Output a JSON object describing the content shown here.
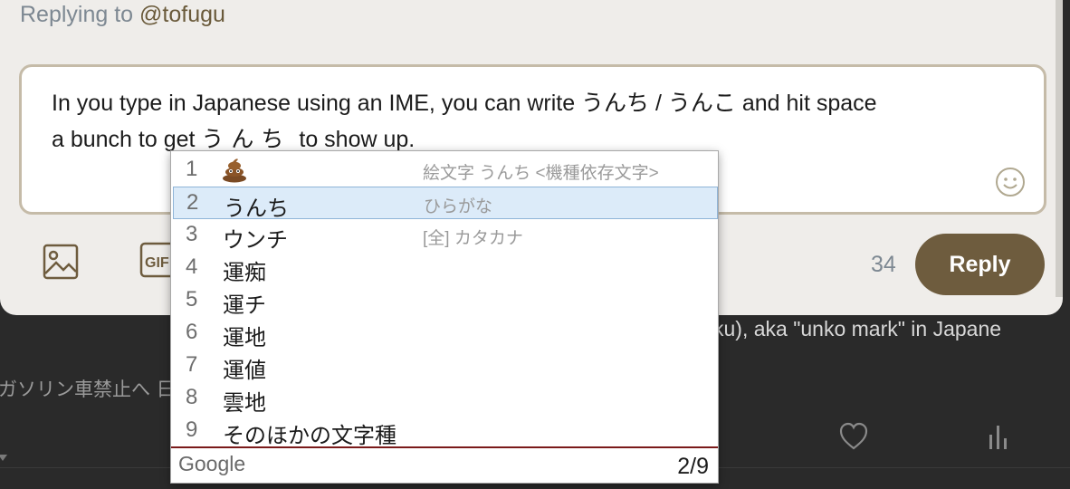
{
  "background": {
    "post_text_fragment": "ku), aka \"unko mark\" in Japane",
    "sidebar_text_fragment": "ガソリン車禁止へ 日"
  },
  "reply_modal": {
    "replying_prefix": "Replying to",
    "replying_handle": "@tofugu",
    "compose": {
      "line1": "In you type in Japanese using an IME, you can write うんち / うんこ and hit space",
      "line2_before": "a bunch to get",
      "line2_composing": "うんち",
      "line2_after": "to show up."
    },
    "char_count": "34",
    "reply_label": "Reply",
    "gif_label": "GIF"
  },
  "ime": {
    "candidates": [
      {
        "num": "1",
        "word": "",
        "icon": "pile-of-poo-icon",
        "annotation": "絵文字 うんち <機種依存文字>"
      },
      {
        "num": "2",
        "word": "うんち",
        "annotation": "ひらがな"
      },
      {
        "num": "3",
        "word": "ウンチ",
        "annotation": "[全] カタカナ"
      },
      {
        "num": "4",
        "word": "運痴",
        "annotation": ""
      },
      {
        "num": "5",
        "word": "運チ",
        "annotation": ""
      },
      {
        "num": "6",
        "word": "運地",
        "annotation": ""
      },
      {
        "num": "7",
        "word": "運値",
        "annotation": ""
      },
      {
        "num": "8",
        "word": "雲地",
        "annotation": ""
      },
      {
        "num": "9",
        "word": "そのほかの文字種",
        "annotation": ""
      }
    ],
    "selected_index": 1,
    "brand": "Google",
    "page_indicator": "2/9"
  },
  "colors": {
    "reply_button": "#6e5c3e",
    "selection": "#dcebf9",
    "ime_divider": "#7a1a1a"
  }
}
